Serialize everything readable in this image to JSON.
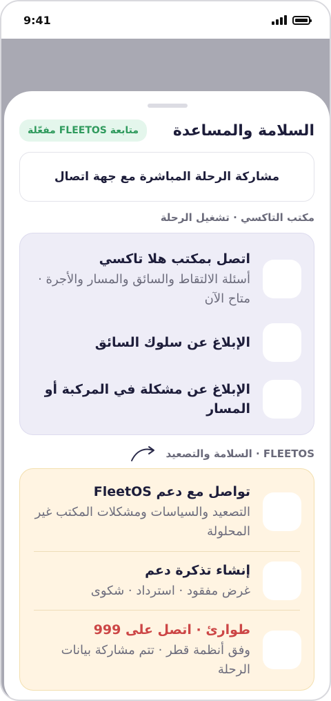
{
  "status_bar": {
    "time": "9:41"
  },
  "sheet": {
    "title": "السلامة والمساعدة",
    "badge": "متابعة FLEETOS مفعّلة",
    "share_button": "مشاركة الرحلة المباشرة مع جهة اتصال"
  },
  "taxi_section": {
    "label": "مكتب التاكسي · تشغيل الرحلة",
    "items": [
      {
        "title": "اتصل بمكتب هلا تاكسي",
        "subtitle": "أسئلة الالتقاط والسائق والمسار والأجرة · متاح الآن"
      },
      {
        "title": "الإبلاغ عن سلوك السائق"
      },
      {
        "title": "الإبلاغ عن مشكلة في المركبة أو المسار"
      }
    ]
  },
  "fleet_section": {
    "label": "FLEETOS · السلامة والتصعيد",
    "icon": "escalate-arrow-icon",
    "items": [
      {
        "title": "تواصل مع دعم FleetOS",
        "subtitle": "التصعيد والسياسات ومشكلات المكتب غير المحلولة"
      },
      {
        "title": "إنشاء تذكرة دعم",
        "subtitle": "غرض مفقود · استرداد · شكوى"
      },
      {
        "title": "طوارئ · اتصل على 999",
        "subtitle": "وفق أنظمة قطر · تتم مشاركة بيانات الرحلة"
      }
    ]
  },
  "colors": {
    "accent_green": "#2f9a5d",
    "danger_red": "#cc4646",
    "taxi_card_bg": "#eeedf7",
    "fleet_card_bg": "#fff4e2"
  }
}
